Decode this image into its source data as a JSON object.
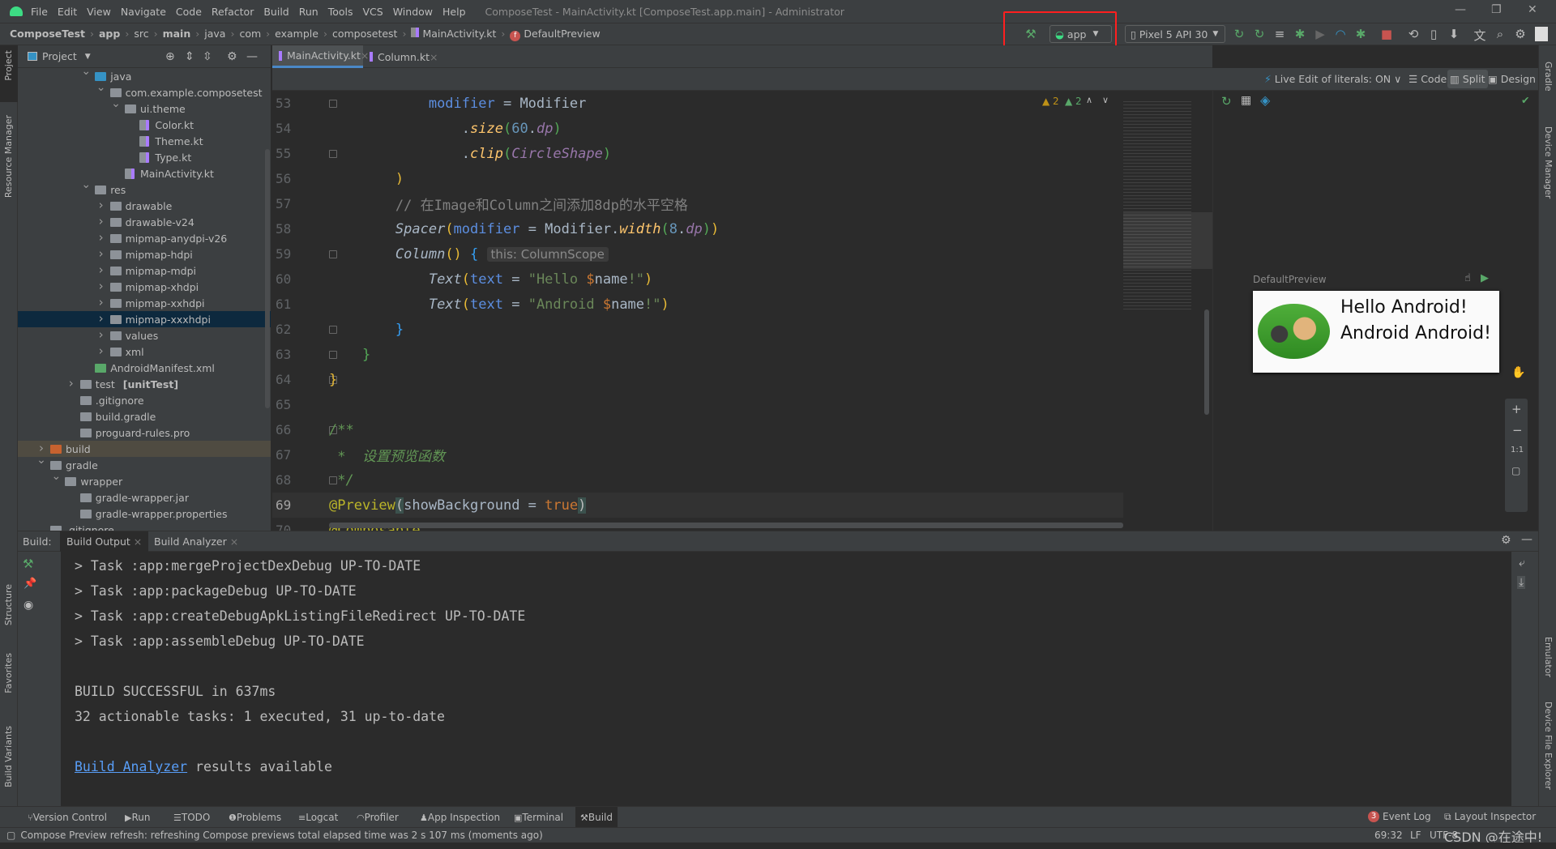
{
  "titlebar": {
    "menus": [
      "File",
      "Edit",
      "View",
      "Navigate",
      "Code",
      "Refactor",
      "Build",
      "Run",
      "Tools",
      "VCS",
      "Window",
      "Help"
    ],
    "title": "ComposeTest - MainActivity.kt [ComposeTest.app.main] - Administrator"
  },
  "breadcrumbs": [
    "ComposeTest",
    "app",
    "src",
    "main",
    "java",
    "com",
    "example",
    "composetest",
    "MainActivity.kt",
    "DefaultPreview"
  ],
  "toolbar": {
    "run_config": "app",
    "device": "Pixel 5 API 30",
    "highlight_color": "#ff1f1f"
  },
  "left_strip": {
    "project": "Project",
    "resource_manager": "Resource Manager",
    "structure": "Structure",
    "favorites": "Favorites",
    "build_variants": "Build Variants"
  },
  "right_strip": {
    "gradle": "Gradle",
    "device_manager": "Device Manager",
    "emulator": "Emulator",
    "device_file_explorer": "Device File Explorer"
  },
  "project": {
    "header": "Project",
    "tree": [
      {
        "label": "java",
        "level": 3,
        "state": "open",
        "icon": "folder-source"
      },
      {
        "label": "com.example.composetest",
        "level": 4,
        "state": "open",
        "icon": "package"
      },
      {
        "label": "ui.theme",
        "level": 5,
        "state": "open",
        "icon": "package"
      },
      {
        "label": "Color.kt",
        "level": 6,
        "icon": "kotlin-file"
      },
      {
        "label": "Theme.kt",
        "level": 6,
        "icon": "kotlin-file"
      },
      {
        "label": "Type.kt",
        "level": 6,
        "icon": "kotlin-file"
      },
      {
        "label": "MainActivity.kt",
        "level": 5,
        "icon": "kotlin-file"
      },
      {
        "label": "res",
        "level": 3,
        "state": "open",
        "icon": "folder-res"
      },
      {
        "label": "drawable",
        "level": 4,
        "state": "closed",
        "icon": "folder"
      },
      {
        "label": "drawable-v24",
        "level": 4,
        "state": "closed",
        "icon": "folder"
      },
      {
        "label": "mipmap-anydpi-v26",
        "level": 4,
        "state": "closed",
        "icon": "folder"
      },
      {
        "label": "mipmap-hdpi",
        "level": 4,
        "state": "closed",
        "icon": "folder"
      },
      {
        "label": "mipmap-mdpi",
        "level": 4,
        "state": "closed",
        "icon": "folder"
      },
      {
        "label": "mipmap-xhdpi",
        "level": 4,
        "state": "closed",
        "icon": "folder"
      },
      {
        "label": "mipmap-xxhdpi",
        "level": 4,
        "state": "closed",
        "icon": "folder"
      },
      {
        "label": "mipmap-xxxhdpi",
        "level": 4,
        "state": "closed",
        "icon": "folder",
        "selected": true
      },
      {
        "label": "values",
        "level": 4,
        "state": "closed",
        "icon": "folder"
      },
      {
        "label": "xml",
        "level": 4,
        "state": "closed",
        "icon": "folder"
      },
      {
        "label": "AndroidManifest.xml",
        "level": 3,
        "icon": "manifest-file"
      },
      {
        "label": "test",
        "suffix": "[unitTest]",
        "level": 2,
        "state": "closed",
        "icon": "folder-test"
      },
      {
        "label": ".gitignore",
        "level": 2,
        "icon": "gitignore-file"
      },
      {
        "label": "build.gradle",
        "level": 2,
        "icon": "gradle-file"
      },
      {
        "label": "proguard-rules.pro",
        "level": 2,
        "icon": "text-file"
      },
      {
        "label": "build",
        "level": 0,
        "state": "closed",
        "icon": "folder-excluded",
        "highlighted": true
      },
      {
        "label": "gradle",
        "level": 0,
        "state": "open",
        "icon": "folder"
      },
      {
        "label": "wrapper",
        "level": 1,
        "state": "open",
        "icon": "folder"
      },
      {
        "label": "gradle-wrapper.jar",
        "level": 2,
        "icon": "jar-file"
      },
      {
        "label": "gradle-wrapper.properties",
        "level": 2,
        "icon": "properties-file"
      },
      {
        "label": ".gitignore",
        "level": 0,
        "icon": "gitignore-file"
      }
    ]
  },
  "editor": {
    "tabs": [
      {
        "label": "MainActivity.kt",
        "active": true
      },
      {
        "label": "Column.kt",
        "active": false
      }
    ],
    "live_edit": "Live Edit of literals: ON",
    "view_modes": [
      "Code",
      "Split",
      "Design"
    ],
    "active_view_mode": "Split",
    "warnings": {
      "weak_warnings": "2",
      "typos": "2"
    },
    "current_line": 69,
    "lines": [
      {
        "n": 53,
        "indent": "            ",
        "tokens": [
          [
            "modifier",
            "param"
          ],
          [
            " = ",
            "plain"
          ],
          [
            "Modifier",
            "plain"
          ]
        ]
      },
      {
        "n": 54,
        "indent": "                ",
        "tokens": [
          [
            ".",
            "plain"
          ],
          [
            "size",
            "fn"
          ],
          [
            "(",
            "paren2"
          ],
          [
            "60",
            "num"
          ],
          [
            ".",
            "plain"
          ],
          [
            "dp",
            "ext"
          ],
          [
            ")",
            "paren2"
          ]
        ]
      },
      {
        "n": 55,
        "indent": "                ",
        "tokens": [
          [
            ".",
            "plain"
          ],
          [
            "clip",
            "fn"
          ],
          [
            "(",
            "paren2"
          ],
          [
            "CircleShape",
            "ext"
          ],
          [
            ")",
            "paren2"
          ]
        ]
      },
      {
        "n": 56,
        "indent": "        ",
        "tokens": [
          [
            ")",
            "paren"
          ]
        ]
      },
      {
        "n": 57,
        "indent": "        ",
        "tokens": [
          [
            "// 在Image和Column之间添加8dp的水平空格",
            "cmt"
          ]
        ]
      },
      {
        "n": 58,
        "indent": "        ",
        "tokens": [
          [
            "Spacer",
            "call"
          ],
          [
            "(",
            "paren"
          ],
          [
            "modifier",
            "param"
          ],
          [
            " = ",
            "plain"
          ],
          [
            "Modifier.",
            "plain"
          ],
          [
            "width",
            "fn"
          ],
          [
            "(",
            "paren2"
          ],
          [
            "8",
            "num"
          ],
          [
            ".",
            "plain"
          ],
          [
            "dp",
            "ext"
          ],
          [
            ")",
            "paren2"
          ],
          [
            ")",
            "paren"
          ]
        ]
      },
      {
        "n": 59,
        "indent": "        ",
        "tokens": [
          [
            "Column",
            "call"
          ],
          [
            "()",
            "paren"
          ],
          [
            " ",
            "plain"
          ],
          [
            "{",
            "paren3"
          ],
          [
            " ",
            "plain"
          ],
          [
            "this: ColumnScope",
            "hint"
          ]
        ]
      },
      {
        "n": 60,
        "indent": "            ",
        "tokens": [
          [
            "Text",
            "call"
          ],
          [
            "(",
            "paren"
          ],
          [
            "text",
            "param"
          ],
          [
            " = ",
            "plain"
          ],
          [
            "\"Hello ",
            "str"
          ],
          [
            "$",
            "tmpl"
          ],
          [
            "name",
            "plain"
          ],
          [
            "!\"",
            "str"
          ],
          [
            ")",
            "paren"
          ]
        ]
      },
      {
        "n": 61,
        "indent": "            ",
        "tokens": [
          [
            "Text",
            "call"
          ],
          [
            "(",
            "paren"
          ],
          [
            "text",
            "param"
          ],
          [
            " = ",
            "plain"
          ],
          [
            "\"Android ",
            "str"
          ],
          [
            "$",
            "tmpl"
          ],
          [
            "name",
            "plain"
          ],
          [
            "!\"",
            "str"
          ],
          [
            ")",
            "paren"
          ]
        ]
      },
      {
        "n": 62,
        "indent": "        ",
        "tokens": [
          [
            "}",
            "paren3"
          ]
        ]
      },
      {
        "n": 63,
        "indent": "    ",
        "tokens": [
          [
            "}",
            "paren2"
          ]
        ]
      },
      {
        "n": 64,
        "indent": "",
        "tokens": [
          [
            "}",
            "paren"
          ]
        ]
      },
      {
        "n": 65,
        "indent": "",
        "tokens": []
      },
      {
        "n": 66,
        "indent": "",
        "tokens": [
          [
            "/**",
            "doc"
          ]
        ]
      },
      {
        "n": 67,
        "indent": " ",
        "tokens": [
          [
            "*  设置预览函数",
            "doc"
          ]
        ]
      },
      {
        "n": 68,
        "indent": " ",
        "tokens": [
          [
            "*/",
            "doc"
          ]
        ]
      },
      {
        "n": 69,
        "indent": "",
        "tokens": [
          [
            "@Preview",
            "ann"
          ],
          [
            "(",
            "match"
          ],
          [
            "showBackground",
            "plain"
          ],
          [
            " = ",
            "plain"
          ],
          [
            "true",
            "bool"
          ],
          [
            ")",
            "match"
          ]
        ]
      },
      {
        "n": 70,
        "indent": "",
        "tokens": [
          [
            "@Composable",
            "ann"
          ]
        ]
      }
    ]
  },
  "preview": {
    "name": "DefaultPreview",
    "lines": [
      "Hello Android!",
      "Android Android!"
    ]
  },
  "build": {
    "label": "Build:",
    "tabs": [
      "Build Output",
      "Build Analyzer"
    ],
    "output": [
      "> Task :app:mergeProjectDexDebug UP-TO-DATE",
      "> Task :app:packageDebug UP-TO-DATE",
      "> Task :app:createDebugApkListingFileRedirect UP-TO-DATE",
      "> Task :app:assembleDebug UP-TO-DATE",
      "",
      "BUILD SUCCESSFUL in 637ms",
      "32 actionable tasks: 1 executed, 31 up-to-date",
      ""
    ],
    "analyzer_link": "Build Analyzer",
    "analyzer_suffix": " results available"
  },
  "tool_windows": [
    "Version Control",
    "Run",
    "TODO",
    "Problems",
    "Logcat",
    "Profiler",
    "App Inspection",
    "Terminal",
    "Build"
  ],
  "active_tool_window": "Build",
  "right_tools": {
    "event_log": "Event Log",
    "event_count": "3",
    "layout_inspector": "Layout Inspector"
  },
  "status": {
    "message": "Compose Preview refresh: refreshing Compose previews total elapsed time was 2 s 107 ms (moments ago)",
    "position": "69:32",
    "line_sep": "LF",
    "encoding": "UTF-8",
    "watermark": "CSDN @在途中!"
  }
}
